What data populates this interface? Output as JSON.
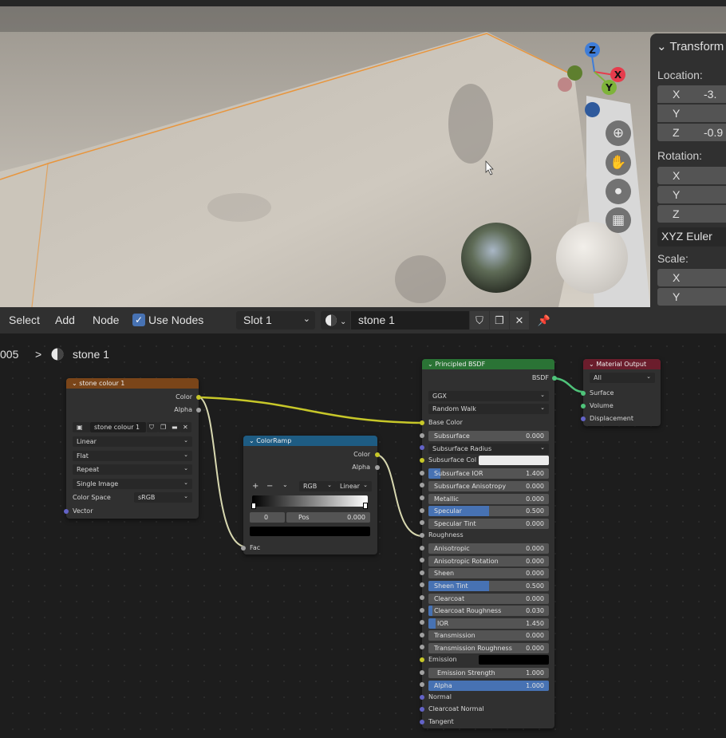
{
  "viewport": {
    "colors": {
      "selection_outline": "#e8953c",
      "gizmo_x": "#e63c4c",
      "gizmo_y": "#7eb33a",
      "gizmo_z": "#3f7dd8"
    },
    "gizmo": {
      "x": "X",
      "y": "Y",
      "z": "Z"
    },
    "nav_icons": [
      "zoom-icon",
      "hand-pan-icon",
      "camera-icon",
      "grid-perspective-icon"
    ]
  },
  "transform_panel": {
    "title": "Transform",
    "location_label": "Location:",
    "location": [
      {
        "axis": "X",
        "value": "-3."
      },
      {
        "axis": "Y",
        "value": ""
      },
      {
        "axis": "Z",
        "value": "-0.9"
      }
    ],
    "rotation_label": "Rotation:",
    "rotation": [
      {
        "axis": "X",
        "value": ""
      },
      {
        "axis": "Y",
        "value": ""
      },
      {
        "axis": "Z",
        "value": ""
      }
    ],
    "rotation_mode": "XYZ Euler",
    "scale_label": "Scale:",
    "scale": [
      {
        "axis": "X",
        "value": ""
      },
      {
        "axis": "Y",
        "value": ""
      }
    ]
  },
  "node_header": {
    "menus": [
      "Select",
      "Add",
      "Node"
    ],
    "use_nodes_label": "Use Nodes",
    "slot": "Slot 1",
    "material_name": "stone 1"
  },
  "breadcrumb": {
    "object": "005",
    "separator": ">",
    "material": "stone 1"
  },
  "image_node": {
    "title": "stone colour 1",
    "color_hex": "#7a4519",
    "out_color": "Color",
    "out_alpha": "Alpha",
    "image_name": "stone colour 1",
    "interpolation": "Linear",
    "projection": "Flat",
    "extension": "Repeat",
    "source": "Single Image",
    "color_space_label": "Color Space",
    "color_space": "sRGB",
    "in_vector": "Vector"
  },
  "colorramp_node": {
    "title": "ColorRamp",
    "color_hex": "#1e5c83",
    "out_color": "Color",
    "out_alpha": "Alpha",
    "add": "+",
    "remove": "−",
    "color_mode": "RGB",
    "interp": "Linear",
    "index": "0",
    "pos_label": "Pos",
    "pos_value": "0.000",
    "in_fac": "Fac"
  },
  "bsdf_node": {
    "title": "Principled BSDF",
    "color_hex": "#2a7335",
    "out_bsdf": "BSDF",
    "distribution": "GGX",
    "subsurface_method": "Random Walk",
    "base_color": "Base Color",
    "subsurface": {
      "label": "Subsurface",
      "value": "0.000",
      "fill": 0
    },
    "subsurface_radius": "Subsurface Radius",
    "subsurface_col": "Subsurface Col",
    "subsurface_ior": {
      "label": "Subsurface IOR",
      "value": "1.400",
      "fill": 0.1
    },
    "subsurface_aniso": {
      "label": "Subsurface Anisotropy",
      "value": "0.000",
      "fill": 0
    },
    "metallic": {
      "label": "Metallic",
      "value": "0.000",
      "fill": 0
    },
    "specular": {
      "label": "Specular",
      "value": "0.500",
      "fill": 0.5
    },
    "specular_tint": {
      "label": "Specular Tint",
      "value": "0.000",
      "fill": 0
    },
    "roughness": "Roughness",
    "anisotropic": {
      "label": "Anisotropic",
      "value": "0.000",
      "fill": 0
    },
    "aniso_rotation": {
      "label": "Anisotropic Rotation",
      "value": "0.000",
      "fill": 0
    },
    "sheen": {
      "label": "Sheen",
      "value": "0.000",
      "fill": 0
    },
    "sheen_tint": {
      "label": "Sheen Tint",
      "value": "0.500",
      "fill": 0.5
    },
    "clearcoat": {
      "label": "Clearcoat",
      "value": "0.000",
      "fill": 0
    },
    "clearcoat_rough": {
      "label": "Clearcoat Roughness",
      "value": "0.030",
      "fill": 0.03
    },
    "ior": {
      "label": "IOR",
      "value": "1.450",
      "fill": 0.06
    },
    "transmission": {
      "label": "Transmission",
      "value": "0.000",
      "fill": 0
    },
    "transmission_rough": {
      "label": "Transmission Roughness",
      "value": "0.000",
      "fill": 0
    },
    "emission": "Emission",
    "emission_strength": {
      "label": "Emission Strength",
      "value": "1.000",
      "fill": 0
    },
    "alpha": {
      "label": "Alpha",
      "value": "1.000",
      "fill": 1
    },
    "normal": "Normal",
    "clearcoat_normal": "Clearcoat Normal",
    "tangent": "Tangent"
  },
  "output_node": {
    "title": "Material Output",
    "color_hex": "#6b1d2c",
    "target": "All",
    "surface": "Surface",
    "volume": "Volume",
    "displacement": "Displacement"
  }
}
